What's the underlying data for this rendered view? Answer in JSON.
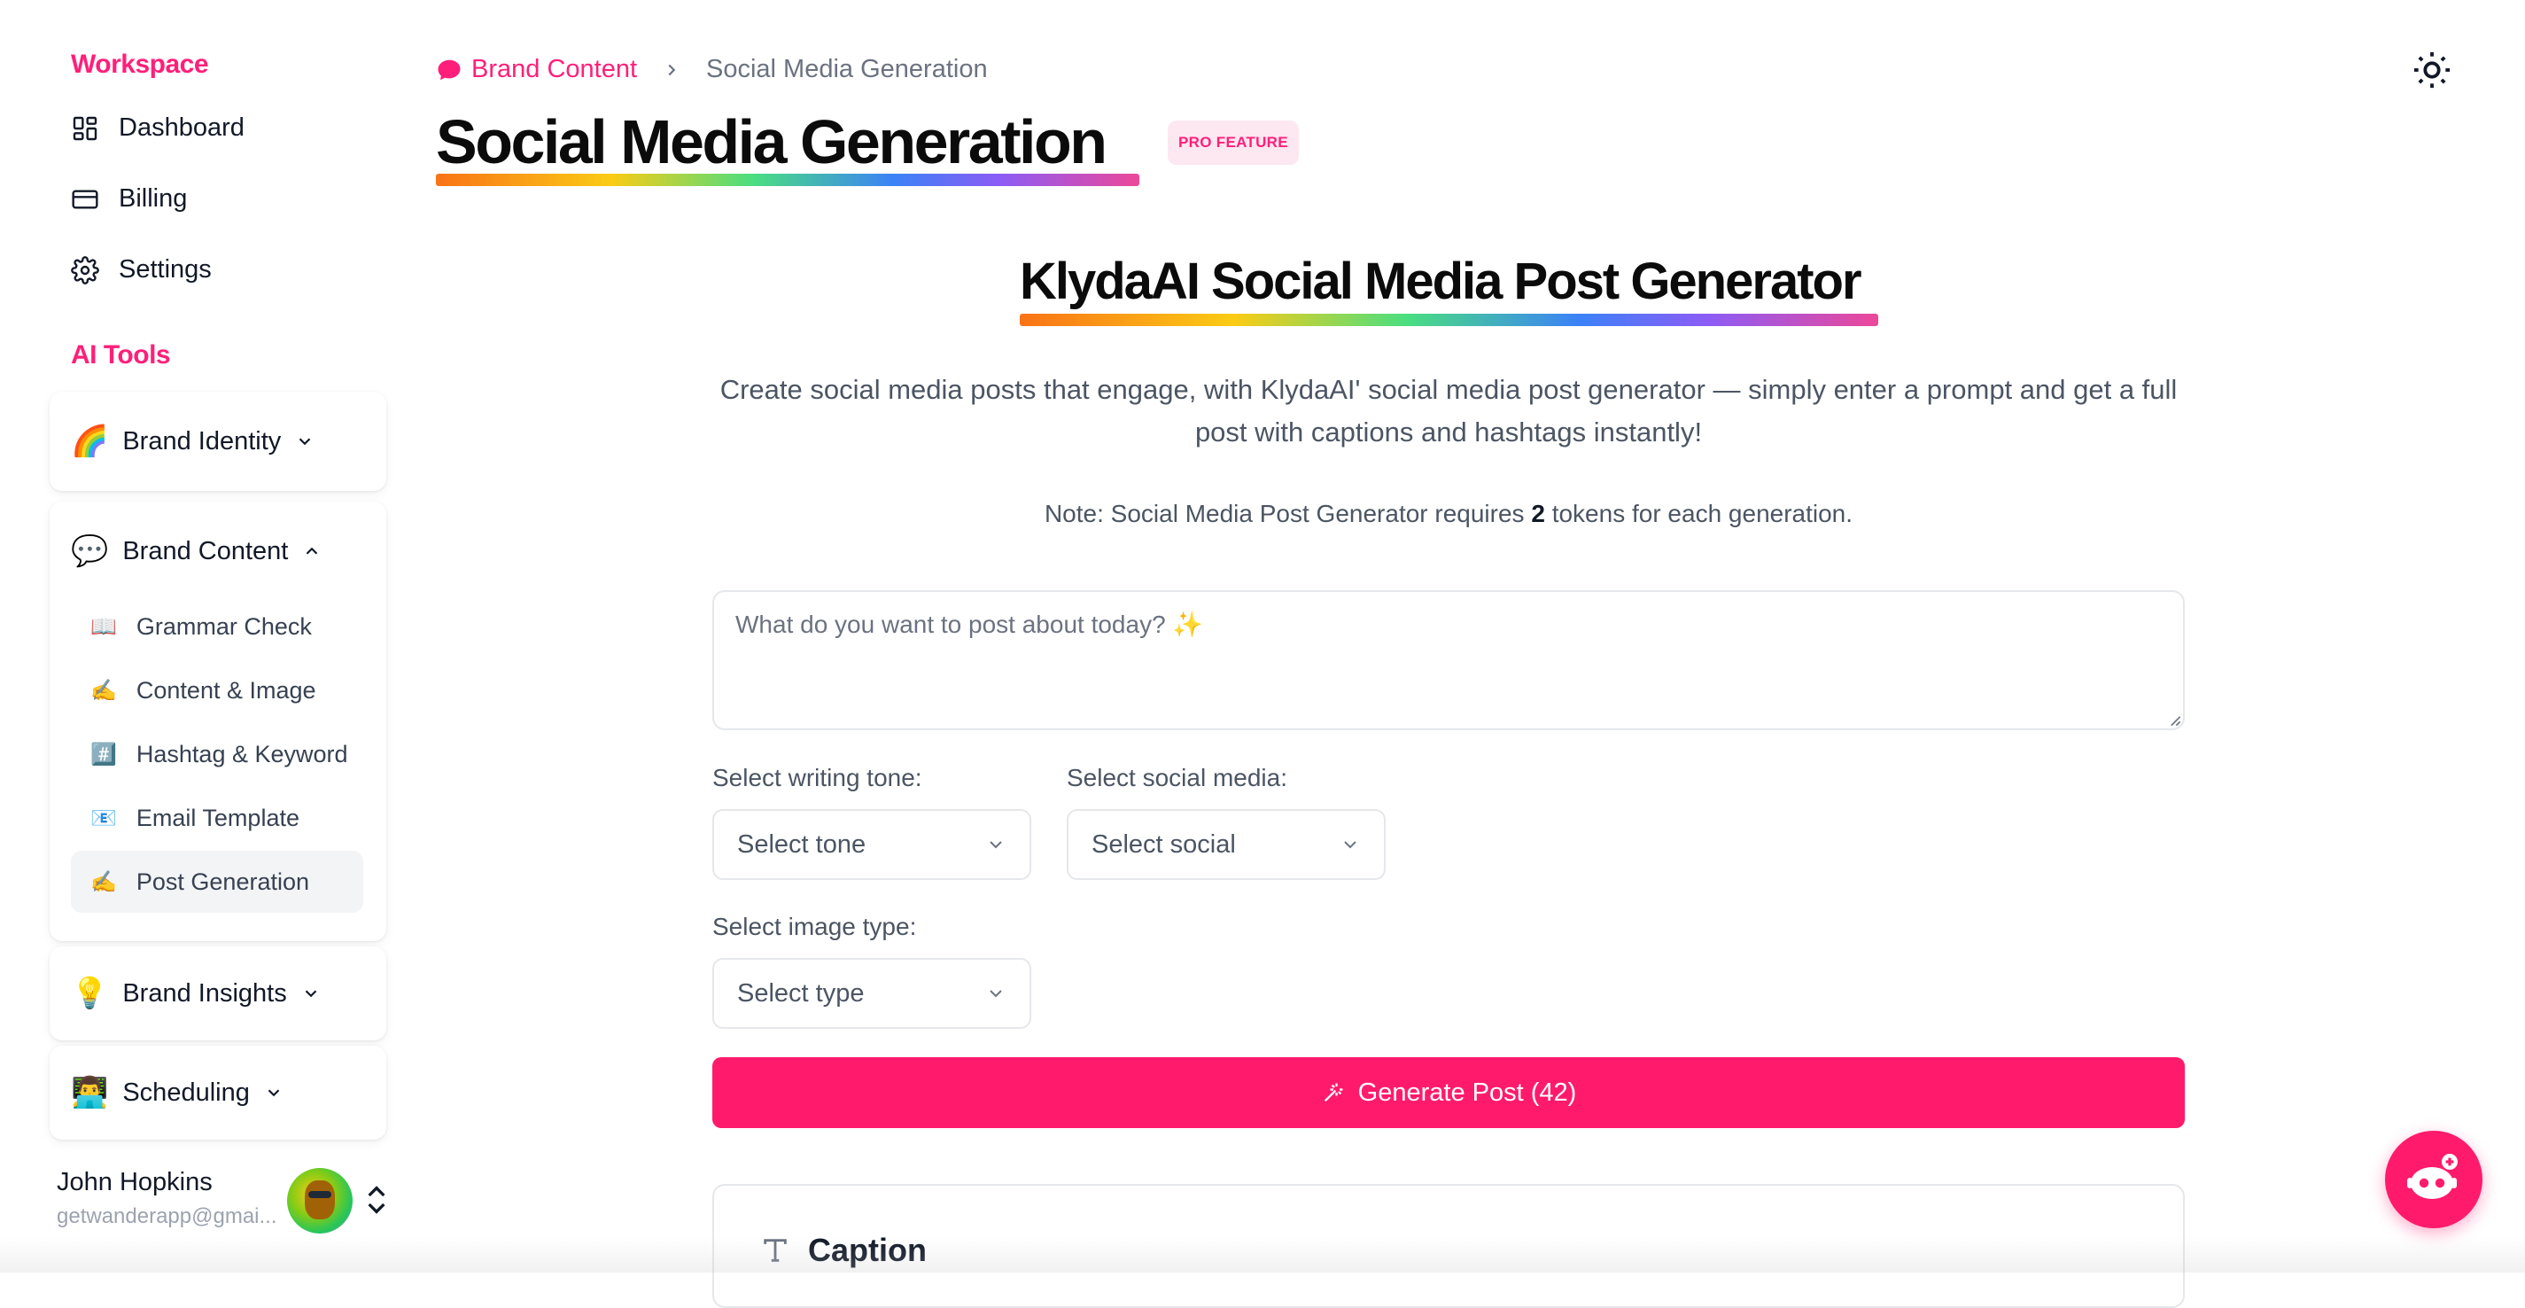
{
  "sidebar": {
    "workspace_title": "Workspace",
    "workspace_items": [
      {
        "label": "Dashboard",
        "icon": "dashboard-icon"
      },
      {
        "label": "Billing",
        "icon": "credit-card-icon"
      },
      {
        "label": "Settings",
        "icon": "gear-icon"
      }
    ],
    "ai_tools_title": "AI Tools",
    "groups": [
      {
        "emoji": "🌈",
        "label": "Brand Identity",
        "expanded": false
      },
      {
        "emoji": "💬",
        "label": "Brand Content",
        "expanded": true,
        "items": [
          {
            "emoji": "📖",
            "label": "Grammar Check"
          },
          {
            "emoji": "✍️",
            "label": "Content & Image"
          },
          {
            "emoji": "#️⃣",
            "label": "Hashtag & Keyword"
          },
          {
            "emoji": "📧",
            "label": "Email Template"
          },
          {
            "emoji": "✍️",
            "label": "Post Generation",
            "active": true
          }
        ]
      },
      {
        "emoji": "💡",
        "label": "Brand Insights",
        "expanded": false
      },
      {
        "emoji": "👨‍💻",
        "label": "Scheduling",
        "expanded": false
      }
    ],
    "user": {
      "name": "John Hopkins",
      "email": "getwanderapp@gmai..."
    }
  },
  "header": {
    "breadcrumb_parent": "Brand Content",
    "breadcrumb_current": "Social Media Generation",
    "page_title": "Social Media Generation",
    "badge": "PRO FEATURE"
  },
  "generator": {
    "title": "KlydaAI Social Media Post Generator",
    "description": "Create social media posts that engage, with KlydaAI' social media post generator — simply enter a prompt and get a full post with captions and hashtags instantly!",
    "note_prefix": "Note: Social Media Post Generator requires ",
    "note_tokens": "2",
    "note_suffix": " tokens for each generation.",
    "prompt_placeholder": "What do you want to post about today? ✨",
    "tone_label": "Select writing tone:",
    "tone_value": "Select tone",
    "social_label": "Select social media:",
    "social_value": "Select social",
    "image_label": "Select image type:",
    "image_value": "Select type",
    "generate_label": "Generate Post (42)",
    "caption_title": "Caption"
  },
  "colors": {
    "accent": "#ff1a6c",
    "accent_text": "#ff1f7a",
    "badge_bg": "#fde7f0"
  }
}
